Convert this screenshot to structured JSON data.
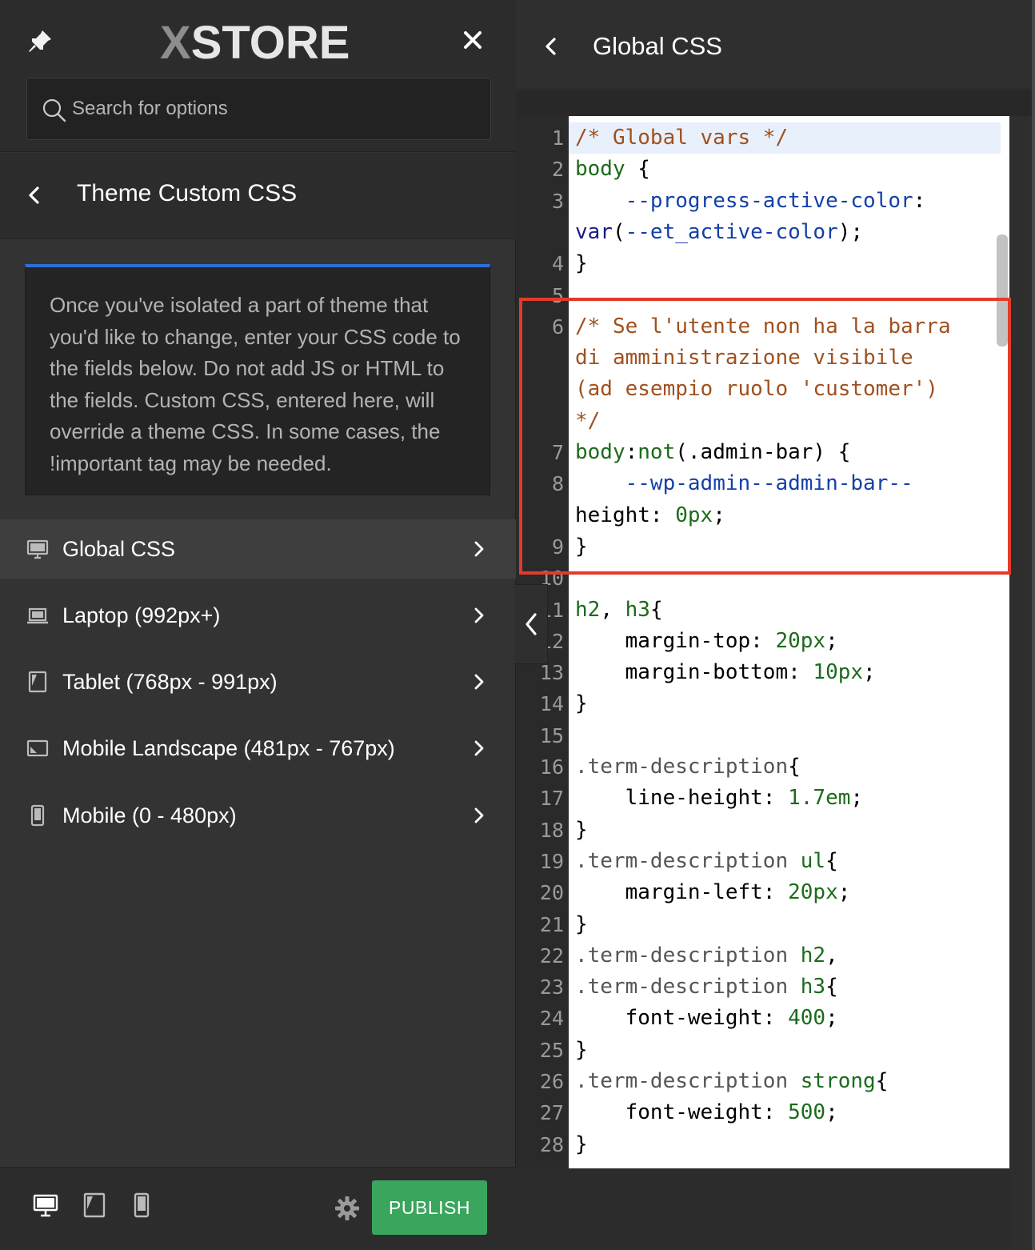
{
  "header": {
    "logo_x": "X",
    "logo_rest": "STORE",
    "pin_icon": "pin-icon",
    "close_icon": "close-icon"
  },
  "search": {
    "placeholder": "Search for options",
    "icon": "search-icon"
  },
  "section": {
    "title": "Theme Custom CSS",
    "back_icon": "chevron-left-icon"
  },
  "description": "Once you've isolated a part of theme that you'd like to change, enter your CSS code to the fields below. Do not add JS or HTML to the fields. Custom CSS, entered here, will override a theme CSS. In some cases, the !important tag may be needed.",
  "menu": [
    {
      "label": "Global CSS",
      "icon": "desktop-icon",
      "active": true
    },
    {
      "label": "Laptop (992px+)",
      "icon": "laptop-icon",
      "active": false
    },
    {
      "label": "Tablet (768px - 991px)",
      "icon": "tablet-icon",
      "active": false
    },
    {
      "label": "Mobile Landscape (481px - 767px)",
      "icon": "mobile-landscape-icon",
      "active": false
    },
    {
      "label": "Mobile (0 - 480px)",
      "icon": "mobile-icon",
      "active": false
    }
  ],
  "footer": {
    "publish_label": "PUBLISH",
    "accent": "#3aa55d"
  },
  "editor_panel": {
    "title": "Global CSS",
    "back_icon": "chevron-left-icon"
  },
  "colors": {
    "highlight_box": "#e33b2a",
    "focus_accent": "#2d6fd6"
  },
  "code_lines": [
    {
      "n": "1",
      "text": "/* Global vars */"
    },
    {
      "n": "2",
      "text": "body {"
    },
    {
      "n": "3",
      "text": "    --progress-active-color:"
    },
    {
      "n": "",
      "text": "var(--et_active-color);"
    },
    {
      "n": "4",
      "text": "}"
    },
    {
      "n": "5",
      "text": ""
    },
    {
      "n": "6",
      "text": "/* Se l'utente non ha la barra"
    },
    {
      "n": "",
      "text": "di amministrazione visibile"
    },
    {
      "n": "",
      "text": "(ad esempio ruolo 'customer')"
    },
    {
      "n": "",
      "text": "*/"
    },
    {
      "n": "7",
      "text": "body:not(.admin-bar) {"
    },
    {
      "n": "8",
      "text": "    --wp-admin--admin-bar--"
    },
    {
      "n": "",
      "text": "height: 0px;"
    },
    {
      "n": "9",
      "text": "}"
    },
    {
      "n": "10",
      "text": ""
    },
    {
      "n": "11",
      "text": "h2, h3{"
    },
    {
      "n": "12",
      "text": "    margin-top: 20px;"
    },
    {
      "n": "13",
      "text": "    margin-bottom: 10px;"
    },
    {
      "n": "14",
      "text": "}"
    },
    {
      "n": "15",
      "text": ""
    },
    {
      "n": "16",
      "text": ".term-description{"
    },
    {
      "n": "17",
      "text": "    line-height: 1.7em;"
    },
    {
      "n": "18",
      "text": "}"
    },
    {
      "n": "19",
      "text": ".term-description ul{"
    },
    {
      "n": "20",
      "text": "    margin-left: 20px;"
    },
    {
      "n": "21",
      "text": "}"
    },
    {
      "n": "22",
      "text": ".term-description h2,"
    },
    {
      "n": "23",
      "text": ".term-description h3{"
    },
    {
      "n": "24",
      "text": "    font-weight: 400;"
    },
    {
      "n": "25",
      "text": "}"
    },
    {
      "n": "26",
      "text": ".term-description strong{"
    },
    {
      "n": "27",
      "text": "    font-weight: 500;"
    },
    {
      "n": "28",
      "text": "}"
    }
  ]
}
